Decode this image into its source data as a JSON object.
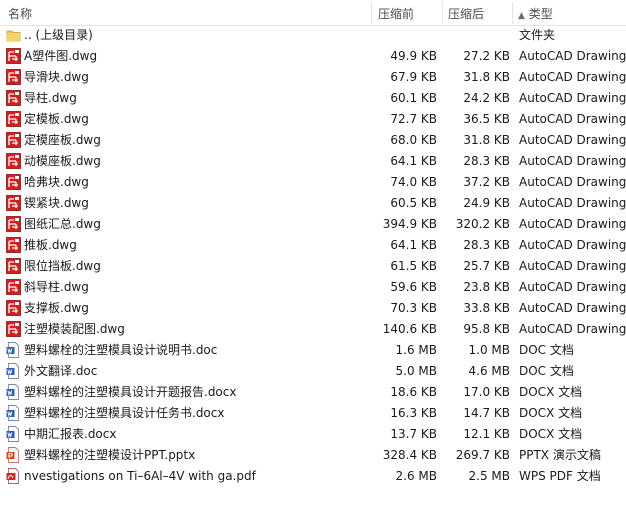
{
  "header": {
    "name": "名称",
    "compressed": "压缩前",
    "packed": "压缩后",
    "type": "类型",
    "sort_arrow": "▲"
  },
  "files": [
    {
      "name": ".. (上级目录)",
      "size": "",
      "packed": "",
      "type": "文件夹",
      "icon": "folder-icon"
    },
    {
      "name": "A塑件图.dwg",
      "size": "49.9 KB",
      "packed": "27.2 KB",
      "type": "AutoCAD Drawing",
      "icon": "dwg-icon"
    },
    {
      "name": "导滑块.dwg",
      "size": "67.9 KB",
      "packed": "31.8 KB",
      "type": "AutoCAD Drawing",
      "icon": "dwg-icon"
    },
    {
      "name": "导柱.dwg",
      "size": "60.1 KB",
      "packed": "24.2 KB",
      "type": "AutoCAD Drawing",
      "icon": "dwg-icon"
    },
    {
      "name": "定模板.dwg",
      "size": "72.7 KB",
      "packed": "36.5 KB",
      "type": "AutoCAD Drawing",
      "icon": "dwg-icon"
    },
    {
      "name": "定模座板.dwg",
      "size": "68.0 KB",
      "packed": "31.8 KB",
      "type": "AutoCAD Drawing",
      "icon": "dwg-icon"
    },
    {
      "name": "动模座板.dwg",
      "size": "64.1 KB",
      "packed": "28.3 KB",
      "type": "AutoCAD Drawing",
      "icon": "dwg-icon"
    },
    {
      "name": "哈弗块.dwg",
      "size": "74.0 KB",
      "packed": "37.2 KB",
      "type": "AutoCAD Drawing",
      "icon": "dwg-icon"
    },
    {
      "name": "锲紧块.dwg",
      "size": "60.5 KB",
      "packed": "24.9 KB",
      "type": "AutoCAD Drawing",
      "icon": "dwg-icon"
    },
    {
      "name": "图纸汇总.dwg",
      "size": "394.9 KB",
      "packed": "320.2 KB",
      "type": "AutoCAD Drawing",
      "icon": "dwg-icon"
    },
    {
      "name": "推板.dwg",
      "size": "64.1 KB",
      "packed": "28.3 KB",
      "type": "AutoCAD Drawing",
      "icon": "dwg-icon"
    },
    {
      "name": "限位挡板.dwg",
      "size": "61.5 KB",
      "packed": "25.7 KB",
      "type": "AutoCAD Drawing",
      "icon": "dwg-icon"
    },
    {
      "name": "斜导柱.dwg",
      "size": "59.6 KB",
      "packed": "23.8 KB",
      "type": "AutoCAD Drawing",
      "icon": "dwg-icon"
    },
    {
      "name": "支撑板.dwg",
      "size": "70.3 KB",
      "packed": "33.8 KB",
      "type": "AutoCAD Drawing",
      "icon": "dwg-icon"
    },
    {
      "name": "注塑模装配图.dwg",
      "size": "140.6 KB",
      "packed": "95.8 KB",
      "type": "AutoCAD Drawing",
      "icon": "dwg-icon"
    },
    {
      "name": "塑料螺栓的注塑模具设计说明书.doc",
      "size": "1.6 MB",
      "packed": "1.0 MB",
      "type": "DOC 文档",
      "icon": "doc-icon"
    },
    {
      "name": "外文翻译.doc",
      "size": "5.0 MB",
      "packed": "4.6 MB",
      "type": "DOC 文档",
      "icon": "doc-icon"
    },
    {
      "name": "塑料螺栓的注塑模具设计开题报告.docx",
      "size": "18.6 KB",
      "packed": "17.0 KB",
      "type": "DOCX 文档",
      "icon": "doc-icon"
    },
    {
      "name": "塑料螺栓的注塑模具设计任务书.docx",
      "size": "16.3 KB",
      "packed": "14.7 KB",
      "type": "DOCX 文档",
      "icon": "doc-icon"
    },
    {
      "name": "中期汇报表.docx",
      "size": "13.7 KB",
      "packed": "12.1 KB",
      "type": "DOCX 文档",
      "icon": "doc-icon"
    },
    {
      "name": "塑料螺栓的注塑模设计PPT.pptx",
      "size": "328.4 KB",
      "packed": "269.7 KB",
      "type": "PPTX 演示文稿",
      "icon": "ppt-icon"
    },
    {
      "name": "nvestigations on Ti–6Al–4V with ga.pdf",
      "size": "2.6 MB",
      "packed": "2.5 MB",
      "type": "WPS PDF 文档",
      "icon": "pdf-icon"
    }
  ],
  "colors": {
    "dwg": "#d21f1f",
    "doc": "#2b5fb4",
    "ppt": "#d24726",
    "pdf": "#c9302c",
    "folder": "#e8c24a"
  }
}
